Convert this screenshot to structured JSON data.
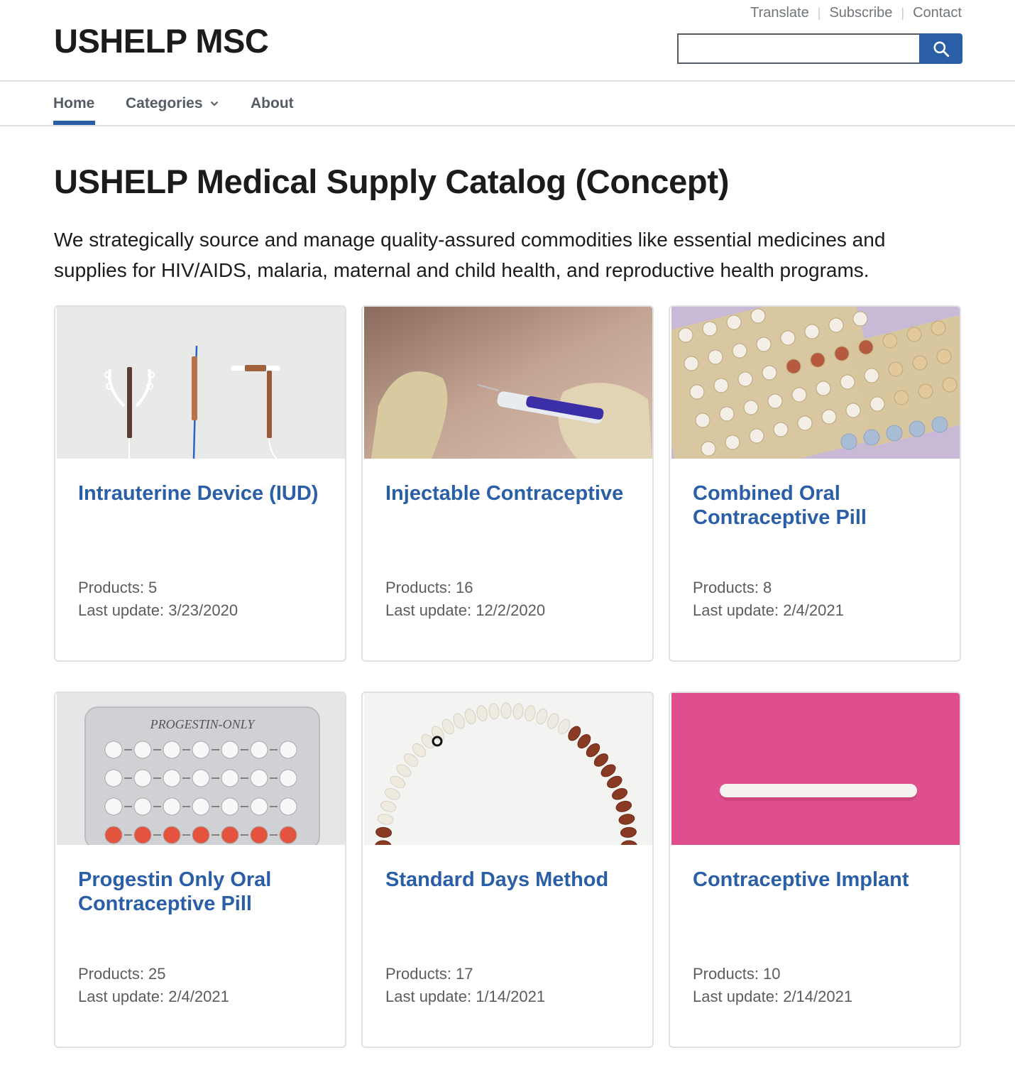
{
  "header": {
    "site_title": "USHELP MSC",
    "util_links": [
      "Translate",
      "Subscribe",
      "Contact"
    ],
    "search": {
      "value": "",
      "button_icon": "search-icon"
    }
  },
  "nav": {
    "items": [
      {
        "label": "Home",
        "active": true
      },
      {
        "label": "Categories",
        "has_dropdown": true
      },
      {
        "label": "About"
      }
    ]
  },
  "main": {
    "title": "USHELP Medical Supply Catalog (Concept)",
    "intro": "We strategically source and manage quality-assured commodities like essential medicines and supplies for HIV/AIDS, malaria, maternal and child health, and reproductive health programs.",
    "cards": [
      {
        "title": "Intrauterine Device (IUD)",
        "products": "Products: 5",
        "last_update": "Last update: 3/23/2020",
        "image": "iud-photo"
      },
      {
        "title": "Injectable Contraceptive",
        "products": "Products: 16",
        "last_update": "Last update: 12/2/2020",
        "image": "injection-photo"
      },
      {
        "title": "Combined Oral Contraceptive Pill",
        "products": "Products: 8",
        "last_update": "Last update: 2/4/2021",
        "image": "pill-packs-photo"
      },
      {
        "title": "Progestin Only Oral Contraceptive Pill",
        "products": "Products: 25",
        "last_update": "Last update: 2/4/2021",
        "image": "progestin-pack-photo",
        "image_text": "PROGESTIN-ONLY"
      },
      {
        "title": "Standard Days Method",
        "products": "Products: 17",
        "last_update": "Last update: 1/14/2021",
        "image": "cycle-beads-photo"
      },
      {
        "title": "Contraceptive Implant",
        "products": "Products: 10",
        "last_update": "Last update: 2/14/2021",
        "image": "implant-rod-photo"
      }
    ]
  },
  "colors": {
    "link_blue": "#2a5fa8",
    "text": "#1b1b1b",
    "muted": "#5c5c5c",
    "border": "#dfe1e2",
    "implant_bg": "#e04f8d"
  }
}
